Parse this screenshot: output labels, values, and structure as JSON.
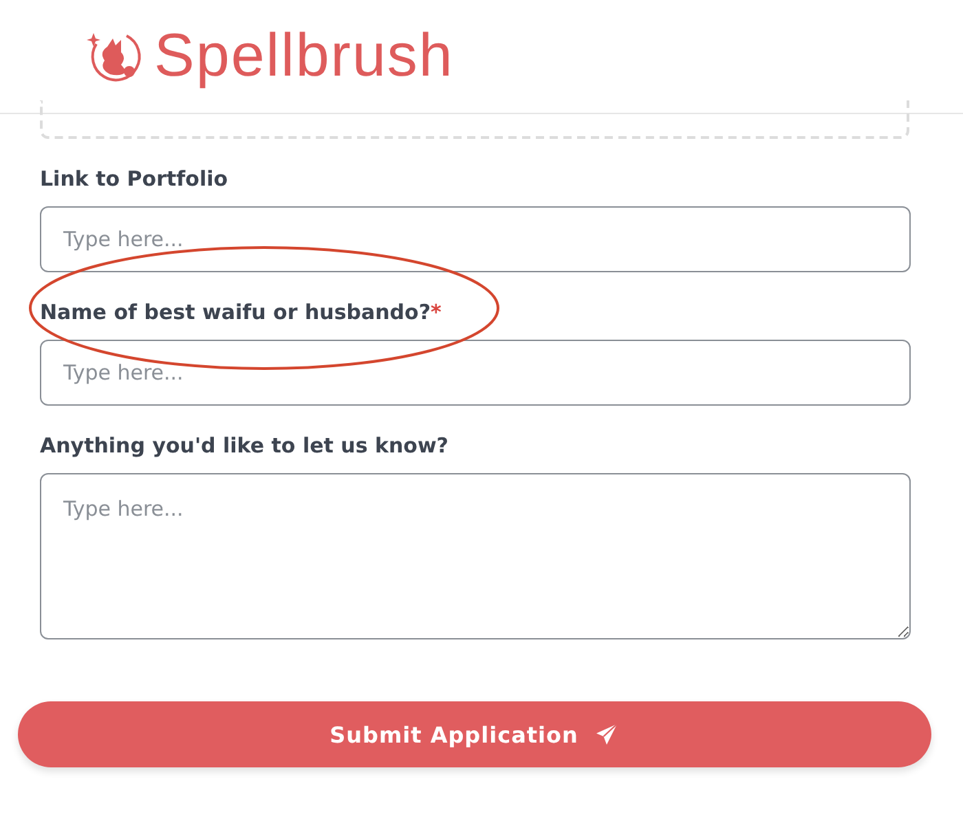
{
  "header": {
    "logo_text": "Spellbrush"
  },
  "fields": [
    {
      "kind": "input",
      "label": "Link to Portfolio",
      "placeholder": "Type here..."
    },
    {
      "kind": "input",
      "label": "Name of best waifu or husbando?",
      "required_mark": "*",
      "placeholder": "Type here...",
      "circled": true
    },
    {
      "kind": "textarea",
      "label": "Anything you'd like to let us know?",
      "placeholder": "Type here..."
    }
  ],
  "submit": {
    "label": "Submit Application"
  }
}
